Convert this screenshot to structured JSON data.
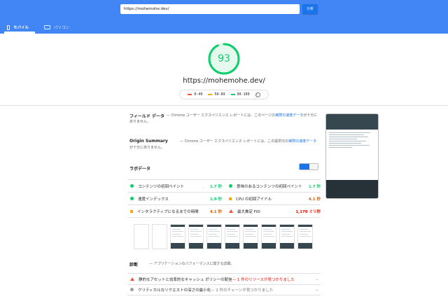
{
  "search": {
    "url": "https://mohemohe.dev/",
    "analyze_label": "分析"
  },
  "tabs": {
    "mobile": "モバイル",
    "desktop": "パソコン"
  },
  "score": {
    "value": "93",
    "url": "https://mohemohe.dev/"
  },
  "legend": {
    "fail": "0-49",
    "average": "50-89",
    "pass": "90-100",
    "info": "i"
  },
  "colors": {
    "header": "#4285f4",
    "pass": "#0cce6b",
    "average": "#ffa400",
    "fail": "#ff4e42"
  },
  "field_data": {
    "title": "フィールド データ",
    "desc_prefix": " — Chrome ユーザー エクスペリエンス レポートには、このページの",
    "desc_link": "実際の速度データ",
    "desc_suffix": "が十分にありません。"
  },
  "origin_summary": {
    "title": "Origin Summary",
    "desc_prefix": " — Chrome ユーザー エクスペリエンス レポートには、この提供元の",
    "desc_link": "実際の速度データ",
    "desc_suffix": "が十分にありません。"
  },
  "lab_data": {
    "title": "ラボデータ"
  },
  "metrics": [
    {
      "label": "コンテンツの初回ペイント",
      "value": "1.7 秒"
    },
    {
      "label": "意味のあるコンテンツの初回ペイント",
      "value": "1.7 秒"
    },
    {
      "label": "速度インデックス",
      "value": "1.9 秒"
    },
    {
      "label": "CPU の初回アイドル",
      "value": "4.1 秒"
    },
    {
      "label": "インタラクティブになるまでの時間",
      "value": "4.1 秒"
    },
    {
      "label": "最大推定 FID",
      "value": "1,170 ミリ秒"
    }
  ],
  "diagnostics": {
    "title": "診断",
    "desc": " — アプリケーションのパフォーマンスに関する詳細。",
    "audits": [
      {
        "label": "静的なアセットと効率的なキャッシュ ポリシーの配信",
        "sub": " — 1 件のリソースが見つかりました"
      },
      {
        "label": "クリティカルなリクエストの深さの最小化",
        "sub": " — 2 件のチェーンが見つかりました"
      }
    ]
  }
}
